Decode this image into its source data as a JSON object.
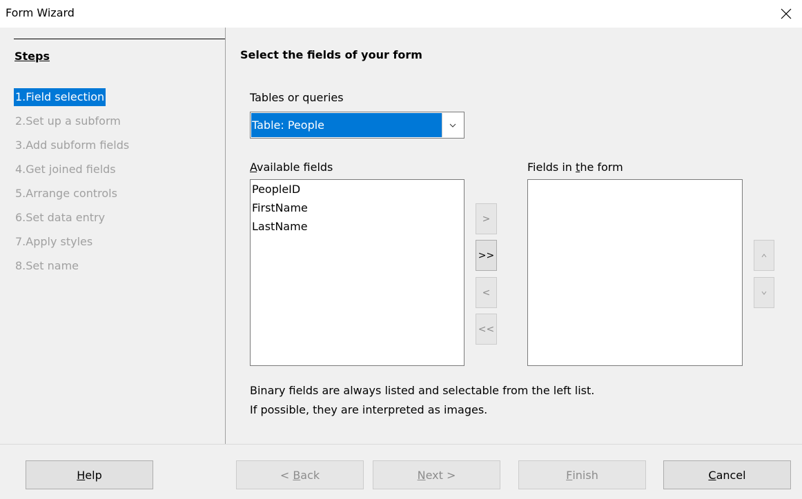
{
  "window": {
    "title": "Form Wizard",
    "close_icon": "close-icon"
  },
  "steps": {
    "heading": "Steps",
    "items": [
      {
        "number": "1.",
        "label": "Field selection",
        "active": true
      },
      {
        "number": "2.",
        "label": "Set up a subform",
        "active": false
      },
      {
        "number": "3.",
        "label": "Add subform fields",
        "active": false
      },
      {
        "number": "4.",
        "label": "Get joined fields",
        "active": false
      },
      {
        "number": "5.",
        "label": "Arrange controls",
        "active": false
      },
      {
        "number": "6.",
        "label": "Set data entry",
        "active": false
      },
      {
        "number": "7.",
        "label": "Apply styles",
        "active": false
      },
      {
        "number": "8.",
        "label": "Set name",
        "active": false
      }
    ]
  },
  "main": {
    "heading": "Select the fields of your form",
    "tables_label": "Tables or queries",
    "tables_value": "Table: People",
    "available_label_mnemonic": "A",
    "available_label_rest": "vailable fields",
    "available_fields": [
      "PeopleID",
      "FirstName",
      "LastName"
    ],
    "form_label_pre": "Fields in ",
    "form_label_mnemonic": "t",
    "form_label_post": "he form",
    "form_fields": [],
    "move_buttons": {
      "add_one": ">",
      "add_all": ">>",
      "remove_one": "<",
      "remove_all": "<<"
    },
    "order_buttons": {
      "up": "^",
      "down": "v"
    },
    "info_line1": "Binary fields are always listed and selectable from the left list.",
    "info_line2": "If possible, they are interpreted as images."
  },
  "footer": {
    "help": {
      "mnemonic": "H",
      "rest": "elp"
    },
    "back": {
      "pre": "< ",
      "mnemonic": "B",
      "rest": "ack"
    },
    "next": {
      "mnemonic": "N",
      "rest": "ext >"
    },
    "finish": {
      "mnemonic": "F",
      "rest": "inish"
    },
    "cancel": {
      "mnemonic": "C",
      "rest": "ancel"
    }
  },
  "colors": {
    "accent": "#0078d7",
    "disabled_text": "#a0a0a0",
    "dialog_bg": "#f0f0f0"
  }
}
